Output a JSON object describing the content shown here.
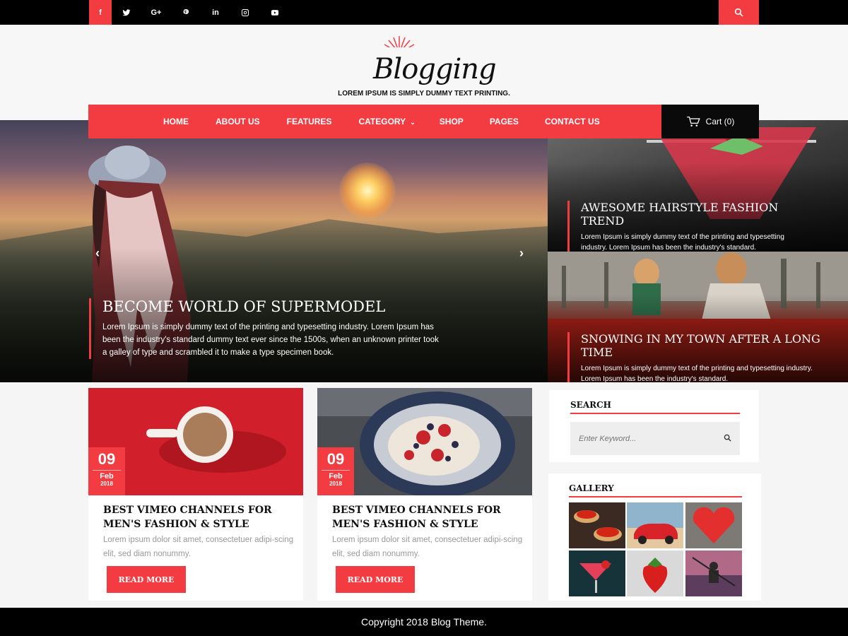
{
  "topbar": {
    "social": [
      {
        "label": "f",
        "icon": "facebook-icon"
      },
      {
        "label": "",
        "icon": "twitter-icon"
      },
      {
        "label": "G+",
        "icon": "google-plus-icon"
      },
      {
        "label": "",
        "icon": "pinterest-icon"
      },
      {
        "label": "in",
        "icon": "linkedin-icon"
      },
      {
        "label": "",
        "icon": "instagram-icon"
      },
      {
        "label": "",
        "icon": "youtube-icon"
      }
    ],
    "search_icon": "search-icon"
  },
  "header": {
    "logo": "Blogging",
    "tagline": "LOREM IPSUM IS SIMPLY DUMMY TEXT PRINTING."
  },
  "nav": {
    "items": [
      "HOME",
      "ABOUT US",
      "FEATURES",
      "CATEGORY",
      "SHOP",
      "PAGES",
      "CONTACT US"
    ],
    "cart": "Cart (0)"
  },
  "hero": {
    "main": {
      "title": "BECOME WORLD OF SUPERMODEL",
      "text": "Lorem Ipsum is simply dummy text of the printing and typesetting industry. Lorem Ipsum has been the industry's standard dummy text ever since the 1500s, when an unknown printer took a galley of type and scrambled it to make a type specimen book."
    },
    "side": [
      {
        "title": "AWESOME HAIRSTYLE FASHION TREND",
        "text": "Lorem Ipsum is simply dummy text of the printing and typesetting industry. Lorem Ipsum has been the industry's standard."
      },
      {
        "title": "SNOWING IN MY TOWN AFTER A LONG TIME",
        "text": "Lorem Ipsum is simply dummy text of the printing and typesetting industry. Lorem Ipsum has been the industry's standard."
      }
    ]
  },
  "posts": [
    {
      "day": "09",
      "month": "Feb",
      "year": "2018",
      "title": "BEST VIMEO CHANNELS FOR MEN'S FASHION & STYLE",
      "excerpt": "Lorem ipsum dolor sit amet, consectetuer adipi-scing elit, sed diam nonummy.",
      "button": "READ MORE"
    },
    {
      "day": "09",
      "month": "Feb",
      "year": "2018",
      "title": "BEST VIMEO CHANNELS FOR MEN'S FASHION & STYLE",
      "excerpt": "Lorem ipsum dolor sit amet, consectetuer adipi-scing elit, sed diam nonummy.",
      "button": "READ MORE"
    }
  ],
  "sidebar": {
    "search": {
      "title": "SEARCH",
      "placeholder": "Enter Keyword..."
    },
    "gallery": {
      "title": "GALLERY"
    }
  },
  "footer": {
    "copyright": "Copyright 2018 Blog Theme."
  },
  "colors": {
    "accent": "#f33c42",
    "dark": "#000000"
  }
}
